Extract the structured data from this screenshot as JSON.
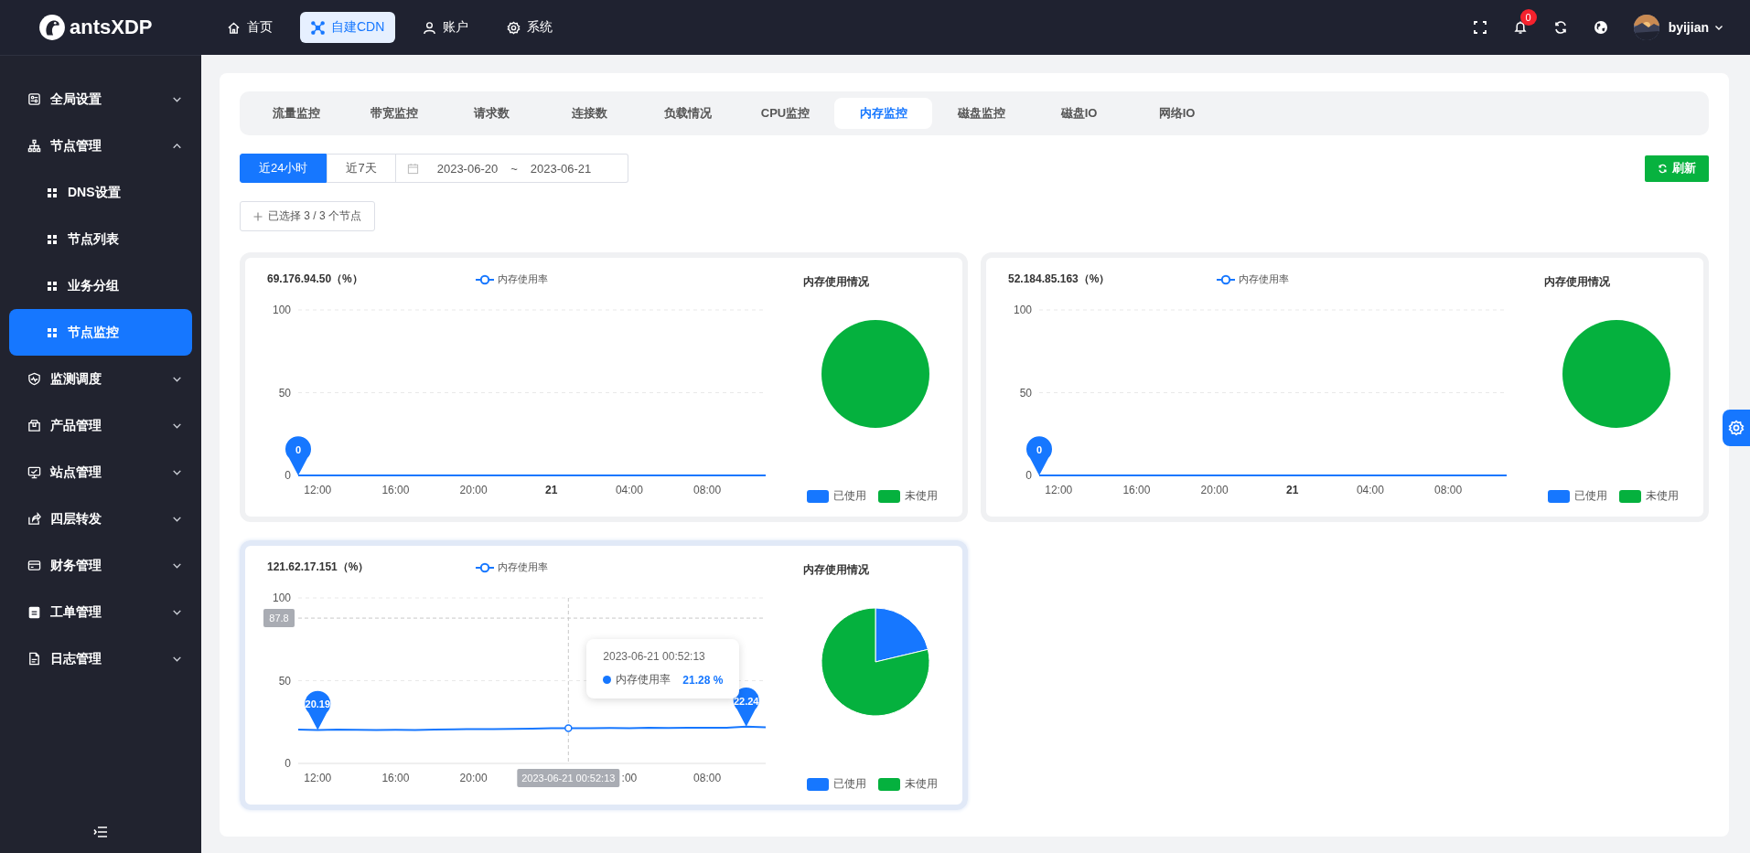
{
  "brand": {
    "name": "antsXDP"
  },
  "top_nav": [
    {
      "label": "首页",
      "selected": false
    },
    {
      "label": "自建CDN",
      "selected": true
    },
    {
      "label": "账户",
      "selected": false
    },
    {
      "label": "系统",
      "selected": false
    }
  ],
  "toolbar": {
    "notifications": "0",
    "user": "byijian"
  },
  "sidebar": {
    "items": [
      {
        "label": "全局设置",
        "expanded": false
      },
      {
        "label": "节点管理",
        "expanded": true,
        "children": [
          {
            "label": "DNS设置",
            "selected": false
          },
          {
            "label": "节点列表",
            "selected": false
          },
          {
            "label": "业务分组",
            "selected": false
          },
          {
            "label": "节点监控",
            "selected": true
          }
        ]
      },
      {
        "label": "监测调度",
        "expanded": false
      },
      {
        "label": "产品管理",
        "expanded": false
      },
      {
        "label": "站点管理",
        "expanded": false
      },
      {
        "label": "四层转发",
        "expanded": false
      },
      {
        "label": "财务管理",
        "expanded": false
      },
      {
        "label": "工单管理",
        "expanded": false
      },
      {
        "label": "日志管理",
        "expanded": false
      }
    ]
  },
  "tabs": [
    {
      "label": "流量监控",
      "selected": false
    },
    {
      "label": "带宽监控",
      "selected": false
    },
    {
      "label": "请求数",
      "selected": false
    },
    {
      "label": "连接数",
      "selected": false
    },
    {
      "label": "负载情况",
      "selected": false
    },
    {
      "label": "CPU监控",
      "selected": false
    },
    {
      "label": "内存监控",
      "selected": true
    },
    {
      "label": "磁盘监控",
      "selected": false
    },
    {
      "label": "磁盘IO",
      "selected": false
    },
    {
      "label": "网络IO",
      "selected": false
    }
  ],
  "range_buttons": [
    {
      "label": "近24小时",
      "selected": true
    },
    {
      "label": "近7天",
      "selected": false
    }
  ],
  "date_range": {
    "start": "2023-06-20",
    "separator": "~",
    "end": "2023-06-21"
  },
  "refresh_button": "刷新",
  "node_selector": "已选择 3 / 3 个节点",
  "cards": [
    {
      "highlighted": false,
      "chart_data": {
        "type": "line",
        "title": "69.176.94.50（%）",
        "x": [
          "2023-06-20T11:00",
          "2023-06-20T13:00",
          "2023-06-20T15:00",
          "2023-06-20T17:00",
          "2023-06-20T19:00",
          "2023-06-20T21:00",
          "2023-06-20T23:00",
          "2023-06-21T01:00",
          "2023-06-21T03:00",
          "2023-06-21T05:00",
          "2023-06-21T07:00",
          "2023-06-21T09:00",
          "2023-06-21T11:00"
        ],
        "xlim": [
          "2023-06-20T11:00",
          "2023-06-21T11:00"
        ],
        "ylim": [
          0,
          100
        ],
        "yticks": [
          0,
          50,
          100
        ],
        "xticks": [
          {
            "value": "2023-06-20T12:00",
            "label": "12:00"
          },
          {
            "value": "2023-06-20T16:00",
            "label": "16:00"
          },
          {
            "value": "2023-06-20T20:00",
            "label": "20:00"
          },
          {
            "value": "2023-06-21T00:00",
            "label": "21"
          },
          {
            "value": "2023-06-21T04:00",
            "label": "04:00"
          },
          {
            "value": "2023-06-21T08:00",
            "label": "08:00"
          }
        ],
        "series": [
          {
            "name": "内存使用率",
            "color": "#1677ff",
            "values": [
              0,
              0,
              0,
              0,
              0,
              0,
              0,
              0,
              0,
              0,
              0,
              0,
              0
            ]
          }
        ],
        "annotations": [
          {
            "x": "2023-06-20T11:00",
            "y": 0,
            "text": "0"
          }
        ]
      },
      "pie": {
        "chart_data": {
          "type": "pie",
          "title": "内存使用情况",
          "categories": [
            "已使用",
            "未使用"
          ],
          "values": [
            0,
            100
          ]
        }
      }
    },
    {
      "highlighted": false,
      "chart_data": {
        "type": "line",
        "title": "52.184.85.163（%）",
        "x": [
          "2023-06-20T11:00",
          "2023-06-20T13:00",
          "2023-06-20T15:00",
          "2023-06-20T17:00",
          "2023-06-20T19:00",
          "2023-06-20T21:00",
          "2023-06-20T23:00",
          "2023-06-21T01:00",
          "2023-06-21T03:00",
          "2023-06-21T05:00",
          "2023-06-21T07:00",
          "2023-06-21T09:00",
          "2023-06-21T11:00"
        ],
        "xlim": [
          "2023-06-20T11:00",
          "2023-06-21T11:00"
        ],
        "ylim": [
          0,
          100
        ],
        "yticks": [
          0,
          50,
          100
        ],
        "xticks": [
          {
            "value": "2023-06-20T12:00",
            "label": "12:00"
          },
          {
            "value": "2023-06-20T16:00",
            "label": "16:00"
          },
          {
            "value": "2023-06-20T20:00",
            "label": "20:00"
          },
          {
            "value": "2023-06-21T00:00",
            "label": "21"
          },
          {
            "value": "2023-06-21T04:00",
            "label": "04:00"
          },
          {
            "value": "2023-06-21T08:00",
            "label": "08:00"
          }
        ],
        "series": [
          {
            "name": "内存使用率",
            "color": "#1677ff",
            "values": [
              0,
              0,
              0,
              0,
              0,
              0,
              0,
              0,
              0,
              0,
              0,
              0,
              0
            ]
          }
        ],
        "annotations": [
          {
            "x": "2023-06-20T11:00",
            "y": 0,
            "text": "0"
          }
        ]
      },
      "pie": {
        "chart_data": {
          "type": "pie",
          "title": "内存使用情况",
          "categories": [
            "已使用",
            "未使用"
          ],
          "values": [
            0,
            100
          ]
        }
      }
    },
    {
      "highlighted": true,
      "chart_data": {
        "type": "line",
        "title": "121.62.17.151（%）",
        "x": [
          "2023-06-20T11:00",
          "2023-06-20T12:00",
          "2023-06-20T13:00",
          "2023-06-20T14:00",
          "2023-06-20T15:00",
          "2023-06-20T16:00",
          "2023-06-20T17:00",
          "2023-06-20T18:00",
          "2023-06-20T19:00",
          "2023-06-20T20:00",
          "2023-06-20T21:00",
          "2023-06-20T22:00",
          "2023-06-20T23:00",
          "2023-06-21T00:00",
          "2023-06-21T00:52:13",
          "2023-06-21T02:00",
          "2023-06-21T03:00",
          "2023-06-21T04:00",
          "2023-06-21T05:00",
          "2023-06-21T06:00",
          "2023-06-21T07:00",
          "2023-06-21T08:00",
          "2023-06-21T09:00",
          "2023-06-21T10:00",
          "2023-06-21T11:00"
        ],
        "xlim": [
          "2023-06-20T11:00",
          "2023-06-21T11:00"
        ],
        "ylim": [
          0,
          100
        ],
        "yticks": [
          0,
          50,
          100
        ],
        "xticks": [
          {
            "value": "2023-06-20T12:00",
            "label": "12:00"
          },
          {
            "value": "2023-06-20T16:00",
            "label": "16:00"
          },
          {
            "value": "2023-06-20T20:00",
            "label": "20:00"
          },
          {
            "value": "2023-06-21T04:00",
            "label": ":00"
          },
          {
            "value": "2023-06-21T08:00",
            "label": "08:00"
          }
        ],
        "series": [
          {
            "name": "内存使用率",
            "color": "#1677ff",
            "values": [
              20.5,
              20.2,
              20.4,
              20.3,
              20.2,
              20.3,
              20.2,
              20.4,
              20.6,
              20.7,
              20.8,
              20.9,
              21.0,
              21.2,
              21.3,
              21.3,
              21.4,
              21.3,
              21.5,
              21.4,
              21.5,
              21.6,
              21.5,
              22.2,
              21.8
            ]
          }
        ],
        "annotations": [
          {
            "x": "2023-06-20T12:00",
            "y": 20.19,
            "text": "20.19"
          },
          {
            "x": "2023-06-21T10:00",
            "y": 22.24,
            "text": "22.24"
          }
        ],
        "ref_lines": [
          {
            "axis": "x",
            "value": "2023-06-21T00:52:13"
          },
          {
            "axis": "y",
            "value": 87.8
          }
        ]
      },
      "hover": {
        "x_label": "2023-06-21 00:52:13",
        "y_label": "87.8",
        "tooltip": {
          "time": "2023-06-21 00:52:13",
          "series": "内存使用率",
          "value": "21.28 %"
        }
      },
      "pie": {
        "chart_data": {
          "type": "pie",
          "title": "内存使用情况",
          "categories": [
            "已使用",
            "未使用"
          ],
          "values": [
            21.28,
            78.72
          ]
        }
      }
    }
  ]
}
